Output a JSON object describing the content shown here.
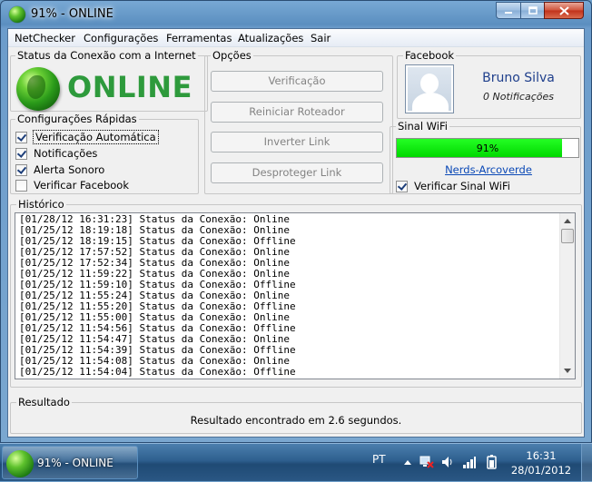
{
  "window": {
    "title": "91% - ONLINE"
  },
  "menu": [
    "NetChecker",
    "Configurações",
    "Ferramentas",
    "Atualizações",
    "Sair"
  ],
  "status": {
    "group_label": "Status da Conexão com a Internet",
    "state": "ONLINE",
    "state_color": "#2e9a3c"
  },
  "quick_settings": {
    "group_label": "Configurações Rápidas",
    "items": [
      {
        "label": "Verificação Automática",
        "checked": true,
        "focused": true
      },
      {
        "label": "Notificações",
        "checked": true
      },
      {
        "label": "Alerta Sonoro",
        "checked": true
      },
      {
        "label": "Verificar Facebook",
        "checked": false
      }
    ]
  },
  "options": {
    "group_label": "Opções",
    "buttons": [
      "Verificação",
      "Reiniciar Roteador",
      "Inverter Link",
      "Desproteger Link"
    ]
  },
  "facebook": {
    "group_label": "Facebook",
    "name": "Bruno Silva",
    "notifications": "0 Notificações"
  },
  "wifi": {
    "group_label": "Sinal WiFi",
    "signal_percent": 91,
    "signal_text": "91%",
    "network_name": "Nerds-Arcoverde",
    "check_label": "Verificar Sinal WiFi",
    "check_checked": true,
    "bar_color": "#00e000"
  },
  "history": {
    "group_label": "Histórico",
    "lines": [
      "[01/28/12 16:31:23] Status da Conexão: Online",
      "[01/25/12 18:19:18] Status da Conexão: Online",
      "[01/25/12 18:19:15] Status da Conexão: Offline",
      "[01/25/12 17:57:52] Status da Conexão: Online",
      "[01/25/12 17:52:34] Status da Conexão: Online",
      "[01/25/12 11:59:22] Status da Conexão: Online",
      "[01/25/12 11:59:10] Status da Conexão: Offline",
      "[01/25/12 11:55:24] Status da Conexão: Online",
      "[01/25/12 11:55:20] Status da Conexão: Offline",
      "[01/25/12 11:55:00] Status da Conexão: Online",
      "[01/25/12 11:54:56] Status da Conexão: Offline",
      "[01/25/12 11:54:47] Status da Conexão: Online",
      "[01/25/12 11:54:39] Status da Conexão: Offline",
      "[01/25/12 11:54:08] Status da Conexão: Online",
      "[01/25/12 11:54:04] Status da Conexão: Offline"
    ]
  },
  "result": {
    "group_label": "Resultado",
    "text": "Resultado encontrado em 2.6 segundos."
  },
  "taskbar": {
    "app_label": "91% - ONLINE",
    "language": "PT",
    "time": "16:31",
    "date": "28/01/2012",
    "tray_icons": [
      "show-hidden-icons",
      "network-icon",
      "volume-icon",
      "signal-icon",
      "battery-icon"
    ]
  }
}
